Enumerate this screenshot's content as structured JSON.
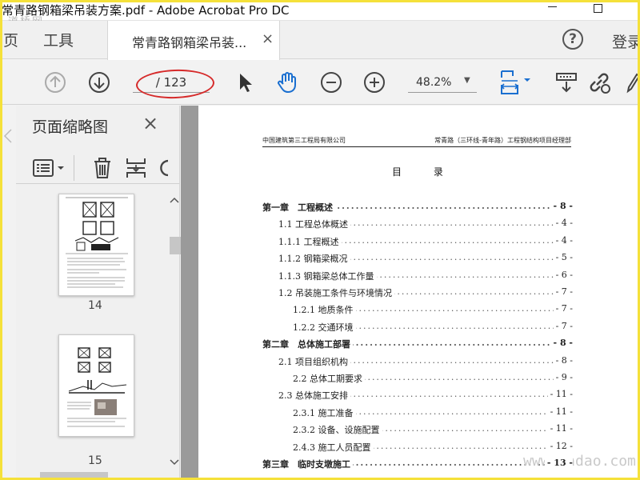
{
  "window": {
    "title": "常青路钢箱梁吊装方案.pdf - Adobe Acrobat Pro DC",
    "watermark_top": "道桥网"
  },
  "menu": {
    "home_partial": "页",
    "tools": "工具"
  },
  "tab": {
    "label": "常青路钢箱梁吊装...",
    "close": "×"
  },
  "header_right": {
    "help": "?",
    "login": "登录"
  },
  "toolbar": {
    "page_label": "/ 123",
    "zoom": "48.2%",
    "icons": [
      "prev-page-icon",
      "next-page-icon",
      "select-arrow-icon",
      "hand-icon",
      "zoom-out-icon",
      "zoom-in-icon",
      "fit-page-icon",
      "scroll-mode-icon",
      "link-icon",
      "sign-icon"
    ]
  },
  "panel": {
    "title": "页面缩略图",
    "close": "×",
    "thumbnails": [
      {
        "page": "14"
      },
      {
        "page": "15"
      }
    ]
  },
  "document": {
    "header_left": "中国建筑第三工程局有限公司",
    "header_right": "常青路（三环线-青年路）工程钢结构项目经理部",
    "title": "目 录",
    "toc": [
      {
        "text": "第一章　工程概述",
        "page": "- 8 -",
        "level": 0
      },
      {
        "text": "1.1 工程总体概述",
        "page": "- 4 -",
        "level": 1
      },
      {
        "text": "1.1.1 工程概述",
        "page": "- 4 -",
        "level": 1
      },
      {
        "text": "1.1.2 钢箱梁概况",
        "page": "- 5 -",
        "level": 1
      },
      {
        "text": "1.1.3 钢箱梁总体工作量",
        "page": "- 6 -",
        "level": 1
      },
      {
        "text": "1.2 吊装施工条件与环境情况",
        "page": "- 7 -",
        "level": 1
      },
      {
        "text": "1.2.1 地质条件",
        "page": "- 7 -",
        "level": 2
      },
      {
        "text": "1.2.2 交通环境",
        "page": "- 7 -",
        "level": 2
      },
      {
        "text": "第二章　总体施工部署",
        "page": "- 8 -",
        "level": 0
      },
      {
        "text": "2.1 项目组织机构",
        "page": "- 8 -",
        "level": 1
      },
      {
        "text": "2.2 总体工期要求",
        "page": "- 9 -",
        "level": 2
      },
      {
        "text": "2.3 总体施工安排",
        "page": "- 11 -",
        "level": 1
      },
      {
        "text": "2.3.1 施工准备",
        "page": "- 11 -",
        "level": 2
      },
      {
        "text": "2.3.2 设备、设施配置",
        "page": "- 11 -",
        "level": 2
      },
      {
        "text": "2.4.3 施工人员配置",
        "page": "- 12 -",
        "level": 2
      },
      {
        "text": "第三章　临时支墩施工",
        "page": "- 13 -",
        "level": 0
      }
    ]
  },
  "watermark_bottom": "www.cndao.com"
}
